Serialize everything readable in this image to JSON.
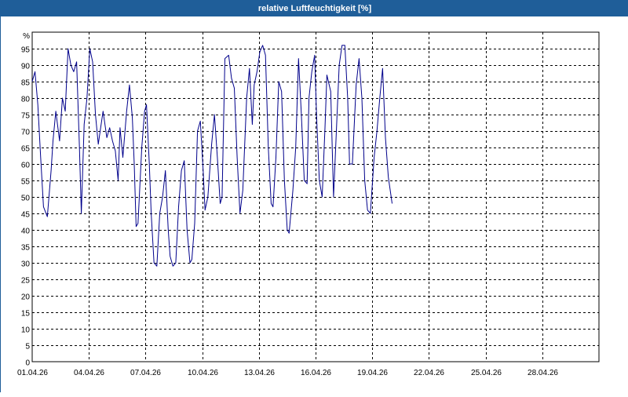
{
  "window": {
    "title": "relative Luftfeuchtigkeit [%]"
  },
  "chart_data": {
    "type": "line",
    "title": "relative Luftfeuchtigkeit [%]",
    "ylabel": "%",
    "xlabel": "",
    "ylim": [
      0,
      100
    ],
    "y_ticks": [
      0,
      5,
      10,
      15,
      20,
      25,
      30,
      35,
      40,
      45,
      50,
      55,
      60,
      65,
      70,
      75,
      80,
      85,
      90,
      95
    ],
    "x_range": [
      "2026-04-01",
      "2026-05-01"
    ],
    "x_tick_labels": [
      "01.04.26",
      "04.04.26",
      "07.04.26",
      "10.04.26",
      "13.04.26",
      "16.04.26",
      "19.04.26",
      "22.04.26",
      "25.04.26",
      "28.04.26"
    ],
    "grid": true,
    "line_color": "#00008b",
    "series": [
      {
        "x_days": [
          0,
          0.15,
          0.3,
          0.45,
          0.6,
          0.8,
          1.0,
          1.1,
          1.25,
          1.45,
          1.6,
          1.75,
          1.9,
          2.05,
          2.2,
          2.35,
          2.5,
          2.6,
          2.75,
          2.9,
          3.05,
          3.2,
          3.35,
          3.5,
          3.6,
          3.75,
          3.95,
          4.1,
          4.25,
          4.4,
          4.55,
          4.65,
          4.8,
          5.0,
          5.15,
          5.3,
          5.4,
          5.5,
          5.6,
          5.8,
          5.95,
          6.05,
          6.2,
          6.3,
          6.45,
          6.6,
          6.75,
          6.9,
          7.05,
          7.2,
          7.3,
          7.45,
          7.6,
          7.75,
          7.9,
          8.05,
          8.2,
          8.35,
          8.45,
          8.6,
          8.75,
          8.9,
          9.05,
          9.15,
          9.3,
          9.5,
          9.65,
          9.8,
          9.95,
          10.05,
          10.2,
          10.4,
          10.55,
          10.7,
          10.85,
          11.0,
          11.15,
          11.35,
          11.5,
          11.65,
          11.75,
          11.9,
          12.05,
          12.2,
          12.35,
          12.5,
          12.65,
          12.75,
          12.9,
          13.05,
          13.2,
          13.35,
          13.5,
          13.6,
          13.8,
          13.95,
          14.1,
          14.25,
          14.4,
          14.55,
          14.65,
          14.8,
          14.95,
          15.05,
          15.2,
          15.35,
          15.5,
          15.6,
          15.8,
          15.95,
          16.1,
          16.25,
          16.4,
          16.55,
          16.7,
          16.8,
          16.95,
          17.15,
          17.3,
          17.45,
          17.6,
          17.75,
          17.9,
          18.1,
          18.25,
          18.4,
          18.55,
          18.7,
          18.85,
          19.05,
          19.2,
          19.35,
          19.5,
          19.65,
          19.8,
          19.95,
          20.1,
          20.25,
          20.35,
          20.5,
          20.65,
          20.8,
          20.95,
          21.1,
          21.25,
          21.35
        ],
        "values": [
          85,
          88,
          78,
          62,
          47,
          44,
          58,
          67,
          76,
          67,
          80,
          76,
          95,
          90,
          88,
          91,
          65,
          45,
          72,
          80,
          95,
          91,
          75,
          66,
          70,
          76,
          68,
          71,
          67,
          64,
          55,
          71,
          62,
          76,
          84,
          74,
          60,
          41,
          42,
          65,
          76,
          78,
          60,
          45,
          30,
          29,
          45,
          50,
          58,
          40,
          32,
          29,
          30,
          47,
          58,
          61,
          40,
          30,
          31,
          42,
          70,
          73,
          58,
          46,
          50,
          66,
          75,
          62,
          48,
          50,
          92,
          93,
          86,
          83,
          62,
          45,
          52,
          80,
          89,
          72,
          84,
          88,
          94,
          96,
          93,
          65,
          48,
          47,
          62,
          85,
          82,
          55,
          40,
          39,
          52,
          65,
          92,
          75,
          55,
          54,
          80,
          88,
          93,
          75,
          55,
          50,
          71,
          87,
          82,
          50,
          70,
          90,
          96,
          96,
          80,
          60,
          60,
          84,
          92,
          80,
          55,
          46,
          45,
          62,
          70,
          80,
          89,
          68,
          56,
          48
        ]
      }
    ]
  }
}
